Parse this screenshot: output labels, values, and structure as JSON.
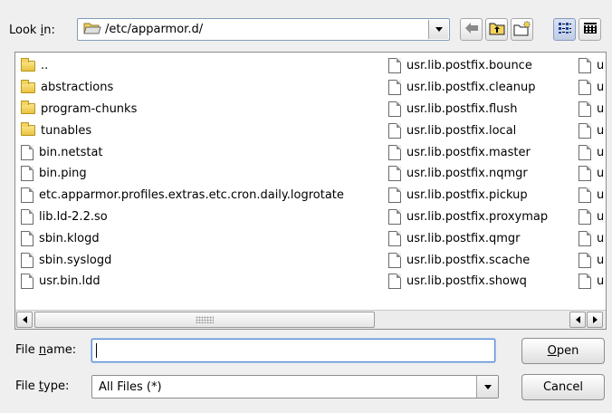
{
  "look_in": {
    "label_prefix": "Look ",
    "label_mnemonic": "i",
    "label_suffix": "n:",
    "path": "/etc/apparmor.d/"
  },
  "files": {
    "column1": [
      {
        "name": "..",
        "icon": "folder-icon"
      },
      {
        "name": "abstractions",
        "icon": "folder-icon"
      },
      {
        "name": "program-chunks",
        "icon": "folder-icon"
      },
      {
        "name": "tunables",
        "icon": "folder-icon"
      },
      {
        "name": "bin.netstat",
        "icon": "file-icon"
      },
      {
        "name": "bin.ping",
        "icon": "file-icon"
      },
      {
        "name": "etc.apparmor.profiles.extras.etc.cron.daily.logrotate",
        "icon": "file-icon"
      },
      {
        "name": "lib.ld-2.2.so",
        "icon": "file-icon"
      },
      {
        "name": "sbin.klogd",
        "icon": "file-icon"
      },
      {
        "name": "sbin.syslogd",
        "icon": "file-icon"
      },
      {
        "name": "usr.bin.ldd",
        "icon": "file-icon"
      }
    ],
    "column2": [
      {
        "name": "usr.lib.postfix.bounce",
        "icon": "file-icon"
      },
      {
        "name": "usr.lib.postfix.cleanup",
        "icon": "file-icon"
      },
      {
        "name": "usr.lib.postfix.flush",
        "icon": "file-icon"
      },
      {
        "name": "usr.lib.postfix.local",
        "icon": "file-icon"
      },
      {
        "name": "usr.lib.postfix.master",
        "icon": "file-icon"
      },
      {
        "name": "usr.lib.postfix.nqmgr",
        "icon": "file-icon"
      },
      {
        "name": "usr.lib.postfix.pickup",
        "icon": "file-icon"
      },
      {
        "name": "usr.lib.postfix.proxymap",
        "icon": "file-icon"
      },
      {
        "name": "usr.lib.postfix.qmgr",
        "icon": "file-icon"
      },
      {
        "name": "usr.lib.postfix.scache",
        "icon": "file-icon"
      },
      {
        "name": "usr.lib.postfix.showq",
        "icon": "file-icon"
      }
    ],
    "column3": [
      {
        "name": "u",
        "icon": "file-icon"
      },
      {
        "name": "u",
        "icon": "file-icon"
      },
      {
        "name": "u",
        "icon": "file-icon"
      },
      {
        "name": "u",
        "icon": "file-icon"
      },
      {
        "name": "u",
        "icon": "file-icon"
      },
      {
        "name": "u",
        "icon": "file-icon"
      },
      {
        "name": "u",
        "icon": "file-icon"
      },
      {
        "name": "u",
        "icon": "file-icon"
      },
      {
        "name": "u",
        "icon": "file-icon"
      },
      {
        "name": "u",
        "icon": "file-icon"
      },
      {
        "name": "u",
        "icon": "file-icon"
      }
    ]
  },
  "file_name": {
    "label_prefix": "File ",
    "label_mnemonic": "n",
    "label_suffix": "ame:",
    "value": ""
  },
  "file_type": {
    "label_prefix": "File ",
    "label_mnemonic": "t",
    "label_suffix": "ype:",
    "value": "All Files (*)"
  },
  "buttons": {
    "open_mnemonic": "O",
    "open_rest": "pen",
    "cancel": "Cancel"
  },
  "colors": {
    "background": "#efefef",
    "focus_border": "#5b8bd2",
    "folder": "#f2d35c"
  }
}
